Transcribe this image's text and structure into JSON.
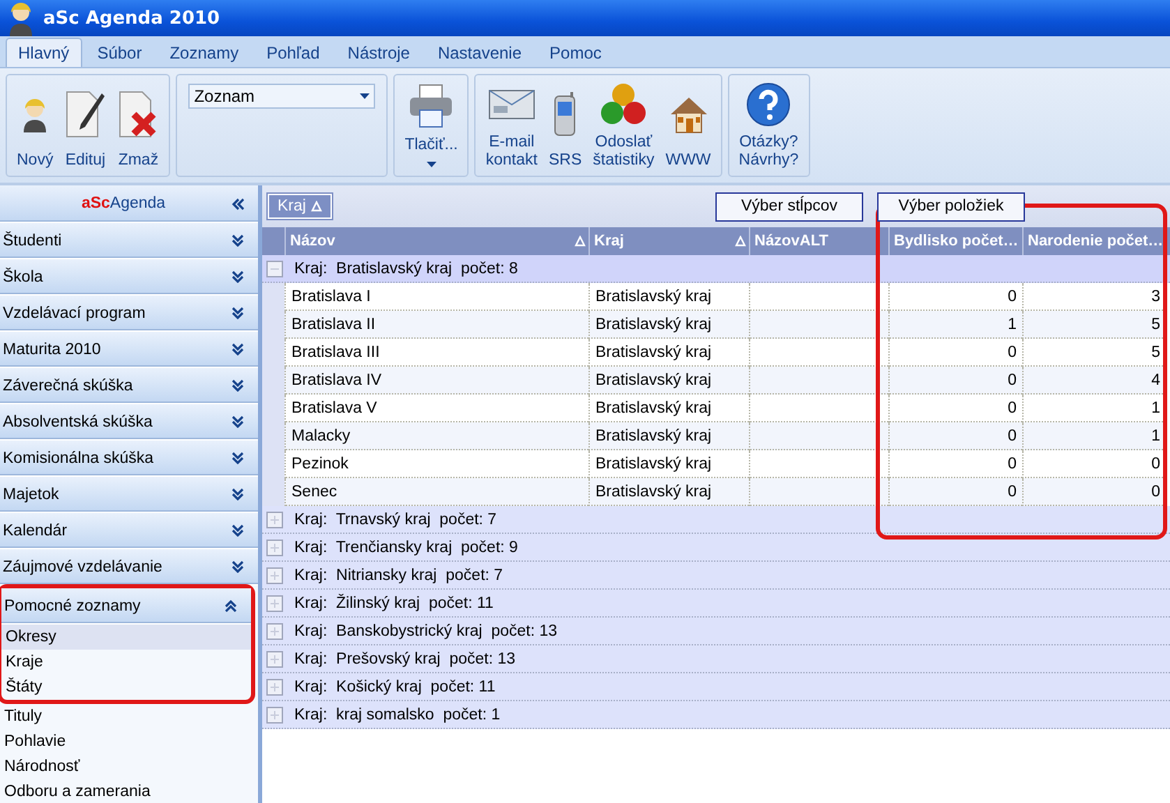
{
  "window": {
    "title": "aSc Agenda 2010"
  },
  "tabs": [
    {
      "label": "Hlavný",
      "selected": true
    },
    {
      "label": "Súbor",
      "selected": false
    },
    {
      "label": "Zoznamy",
      "selected": false
    },
    {
      "label": "Pohľad",
      "selected": false
    },
    {
      "label": "Nástroje",
      "selected": false
    },
    {
      "label": "Nastavenie",
      "selected": false
    },
    {
      "label": "Pomoc",
      "selected": false
    }
  ],
  "ribbon": {
    "groups": [
      {
        "kind": "buttons",
        "buttons": [
          {
            "kind": "new",
            "label": "Nový"
          },
          {
            "kind": "edit",
            "label": "Edituj"
          },
          {
            "kind": "delete",
            "label": "Zmaž"
          }
        ]
      },
      {
        "kind": "dropdown",
        "value": "Zoznam"
      },
      {
        "kind": "buttons",
        "buttons": [
          {
            "kind": "print",
            "label": "Tlačiť...",
            "has_menu": true
          }
        ]
      },
      {
        "kind": "buttons",
        "buttons": [
          {
            "kind": "email",
            "label": "E-mail\nkontakt"
          },
          {
            "kind": "phone",
            "label": "SRS"
          },
          {
            "kind": "stats",
            "label": "Odoslať\nštatistiky"
          },
          {
            "kind": "home",
            "label": "WWW"
          }
        ]
      },
      {
        "kind": "buttons",
        "buttons": [
          {
            "kind": "help",
            "label": "Otázky?\nNávrhy?"
          }
        ]
      }
    ]
  },
  "sidebar": {
    "title_accent": "aSc",
    "title": "Agenda",
    "sections": [
      {
        "label": "Študenti",
        "expanded": false
      },
      {
        "label": "Škola",
        "expanded": false
      },
      {
        "label": "Vzdelávací program",
        "expanded": false
      },
      {
        "label": "Maturita 2010",
        "expanded": false
      },
      {
        "label": "Záverečná skúška",
        "expanded": false
      },
      {
        "label": "Absolventská skúška",
        "expanded": false
      },
      {
        "label": "Komisionálna skúška",
        "expanded": false
      },
      {
        "label": "Majetok",
        "expanded": false
      },
      {
        "label": "Kalendár",
        "expanded": false
      },
      {
        "label": "Záujmové vzdelávanie",
        "expanded": false
      },
      {
        "label": "Pomocné zoznamy",
        "expanded": true,
        "highlighted": true,
        "children": [
          {
            "label": "Okresy",
            "selected": true,
            "highlighted": true
          },
          {
            "label": "Kraje",
            "selected": false,
            "highlighted": true
          },
          {
            "label": "Štáty",
            "selected": false,
            "highlighted": true
          },
          {
            "label": "Tituly",
            "selected": false,
            "highlighted": false
          },
          {
            "label": "Pohlavie",
            "selected": false,
            "highlighted": false
          },
          {
            "label": "Národnosť",
            "selected": false,
            "highlighted": false
          },
          {
            "label": "Odboru a zamerania",
            "selected": false,
            "highlighted": false
          }
        ]
      }
    ]
  },
  "grid": {
    "group_by": {
      "label": "Kraj",
      "sorted": true
    },
    "buttons": [
      "Výber stĺpcov",
      "Výber položiek"
    ],
    "columns": [
      {
        "label": "Názov",
        "sorted": true,
        "highlighted": false
      },
      {
        "label": "Kraj",
        "sorted": true,
        "highlighted": false
      },
      {
        "label": "NázovALT",
        "sorted": false,
        "highlighted": false
      },
      {
        "label": "Bydlisko počet…",
        "sorted": false,
        "highlighted": true
      },
      {
        "label": "Narodenie počet…",
        "sorted": false,
        "highlighted": true
      }
    ],
    "groups": [
      {
        "label": "Kraj:  Bratislavský kraj  počet: 8",
        "expanded": true,
        "selected": true,
        "rows": [
          {
            "name": "Bratislava I",
            "region": "Bratislavský kraj",
            "residence": "0",
            "birth": "3"
          },
          {
            "name": "Bratislava II",
            "region": "Bratislavský kraj",
            "residence": "1",
            "birth": "5"
          },
          {
            "name": "Bratislava III",
            "region": "Bratislavský kraj",
            "residence": "0",
            "birth": "5"
          },
          {
            "name": "Bratislava IV",
            "region": "Bratislavský kraj",
            "residence": "0",
            "birth": "4"
          },
          {
            "name": "Bratislava V",
            "region": "Bratislavský kraj",
            "residence": "0",
            "birth": "1"
          },
          {
            "name": "Malacky",
            "region": "Bratislavský kraj",
            "residence": "0",
            "birth": "1"
          },
          {
            "name": "Pezinok",
            "region": "Bratislavský kraj",
            "residence": "0",
            "birth": "0"
          },
          {
            "name": "Senec",
            "region": "Bratislavský kraj",
            "residence": "0",
            "birth": "0"
          }
        ]
      },
      {
        "label": "Kraj:  Trnavský kraj  počet: 7",
        "expanded": false,
        "selected": false
      },
      {
        "label": "Kraj:  Trenčiansky kraj  počet: 9",
        "expanded": false,
        "selected": false
      },
      {
        "label": "Kraj:  Nitriansky kraj  počet: 7",
        "expanded": false,
        "selected": false
      },
      {
        "label": "Kraj:  Žilinský kraj  počet: 11",
        "expanded": false,
        "selected": false
      },
      {
        "label": "Kraj:  Banskobystrický kraj  počet: 13",
        "expanded": false,
        "selected": false
      },
      {
        "label": "Kraj:  Prešovský kraj  počet: 13",
        "expanded": false,
        "selected": false
      },
      {
        "label": "Kraj:  Košický kraj  počet: 11",
        "expanded": false,
        "selected": false
      },
      {
        "label": "Kraj:  kraj somalsko  počet: 1",
        "expanded": false,
        "selected": false
      }
    ]
  }
}
